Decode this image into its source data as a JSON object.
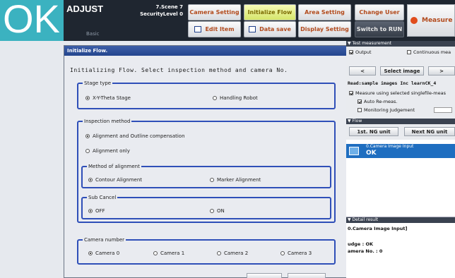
{
  "status": {
    "judgement": "OK"
  },
  "header": {
    "mode": "ADJUST",
    "sub": "Basic",
    "scene_line1": "7.Scene 7",
    "scene_line2": "SecurityLevel 0",
    "buttons": {
      "camera_setting": "Camera Setting",
      "initialize_flow": "Initialize Flow",
      "area_setting": "Area Setting",
      "change_user": "Change User",
      "edit_item": "Edit Item",
      "data_save": "Data save",
      "display_setting": "Display Setting",
      "switch_to_run": "Switch to RUN",
      "measure": "Measure"
    }
  },
  "dialog": {
    "title": "Initialize Flow.",
    "description": "Initializing Flow. Select inspection method and camera No.",
    "stage_type": {
      "label": "Stage type",
      "options": [
        "X-Y-Theta Stage",
        "Handling Robot"
      ],
      "selected": 0
    },
    "inspection_method": {
      "label": "Inspection method",
      "options": [
        "Alignment and Outline compensation",
        "Alignment only"
      ],
      "selected": 0
    },
    "method_of_alignment": {
      "label": "Method of alignment",
      "options": [
        "Contour Alignment",
        "Marker Alignment"
      ],
      "selected": 0
    },
    "sub_cancel": {
      "label": "Sub Cancel",
      "options": [
        "OFF",
        "ON"
      ],
      "selected": 0
    },
    "camera_number": {
      "label": "Camera number",
      "options": [
        "Camera 0",
        "Camera 1",
        "Camera 2",
        "Camera 3"
      ],
      "selected": 0
    }
  },
  "right_panel": {
    "test_measurement": {
      "header": "Test measurement",
      "output_label": "Output",
      "output_checked": true,
      "continuous_label": "Continuous mea",
      "continuous_checked": false,
      "prev_label": "<",
      "select_image_label": "Select image",
      "next_label": ">",
      "image_info": "Read:sample images Inc learnCK_4",
      "measure_selected_label": "Measure using selected singlefile-meas",
      "auto_remeas_label": "Auto Re-meas.",
      "monitoring_label": "Monitoring Judgement"
    },
    "flow": {
      "header": "Flow",
      "first_ng_label": "1st. NG unit",
      "next_ng_label": "Next NG unit",
      "item_name": "0.Camera Image Input",
      "item_status": "OK"
    },
    "detail_result": {
      "header": "Detail result",
      "title": "0.Camera Image Input]",
      "judge_line": "udge : OK",
      "camera_line": "amera No. : 0"
    }
  },
  "colors": {
    "ok_accent": "#3bb2c0",
    "header_bg": "#1f2630",
    "active_tab": "#e3ee86",
    "dialog_title_bar": "#24468e",
    "group_border": "#2f4fb8",
    "selected_flow_item": "#1f6ec0"
  }
}
